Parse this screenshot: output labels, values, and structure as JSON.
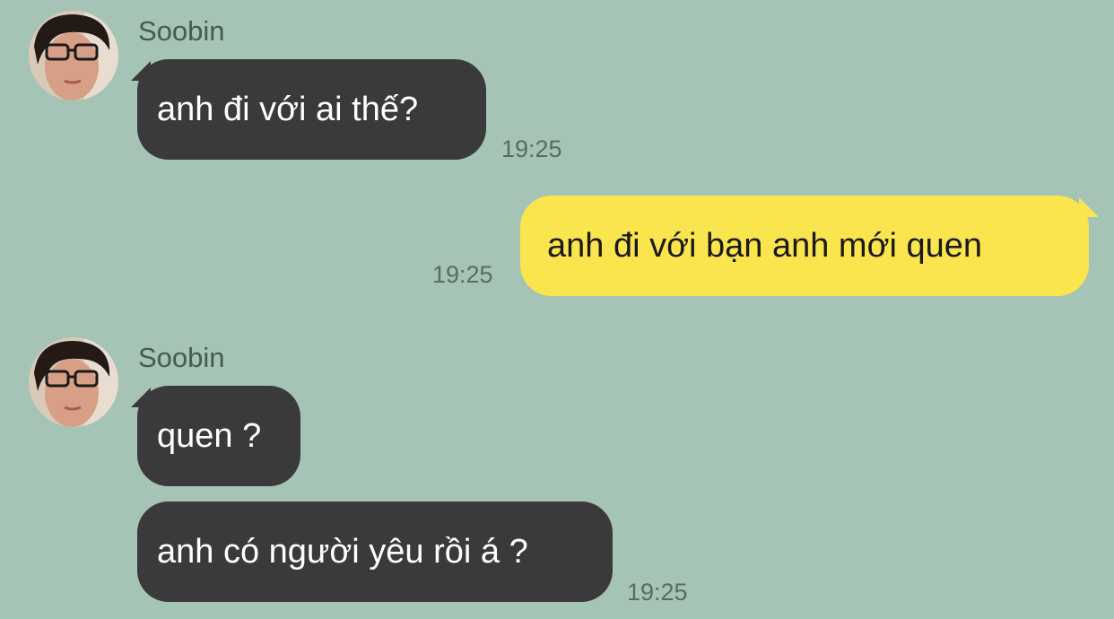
{
  "messages": [
    {
      "sender": "Soobin",
      "direction": "in",
      "text": "anh đi với ai thế?",
      "time": "19:25",
      "avatar": "soobin-avatar-photo"
    },
    {
      "direction": "out",
      "text": "anh đi với bạn anh mới quen",
      "time": "19:25"
    },
    {
      "sender": "Soobin",
      "direction": "in",
      "text": "quen ?",
      "avatar": "soobin-avatar-photo"
    },
    {
      "direction": "in",
      "text": "anh có người yêu rồi á ?",
      "time": "19:25"
    }
  ],
  "colors": {
    "chat_background": "#a5c4b6",
    "incoming_bubble": "#3a3a3c",
    "outgoing_bubble": "#fbe54e",
    "timestamp": "#5a6b62"
  }
}
